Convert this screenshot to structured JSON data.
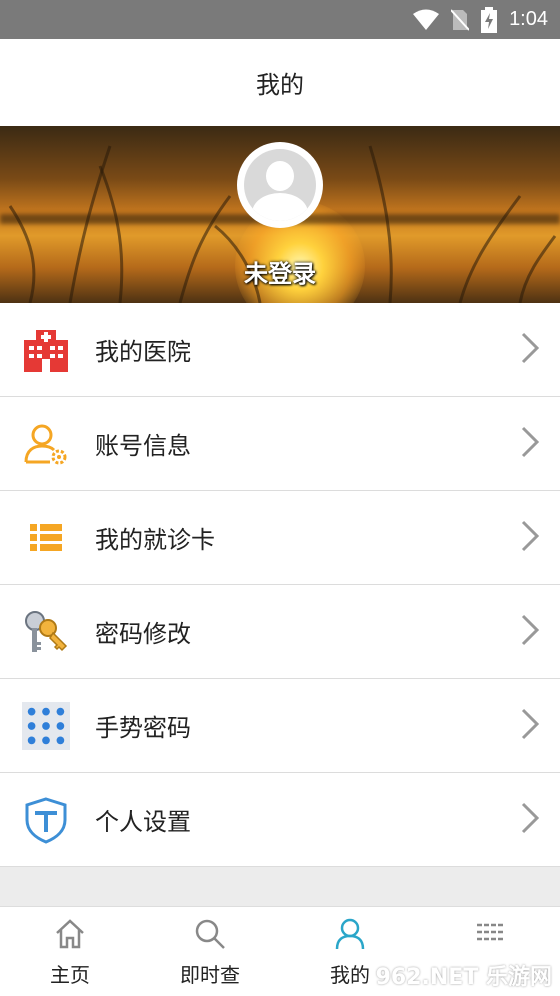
{
  "status_bar": {
    "time": "1:04"
  },
  "title_bar": {
    "title": "我的"
  },
  "profile": {
    "login_label": "未登录"
  },
  "menu": [
    {
      "label": "我的医院",
      "icon": "hospital-icon"
    },
    {
      "label": "账号信息",
      "icon": "account-settings-icon"
    },
    {
      "label": "我的就诊卡",
      "icon": "card-list-icon"
    },
    {
      "label": "密码修改",
      "icon": "key-icon"
    },
    {
      "label": "手势密码",
      "icon": "gesture-grid-icon"
    },
    {
      "label": "个人设置",
      "icon": "shield-icon"
    }
  ],
  "tabbar": [
    {
      "label": "主页",
      "icon": "home-icon"
    },
    {
      "label": "即时查",
      "icon": "search-icon"
    },
    {
      "label": "我的",
      "icon": "user-icon",
      "active": true
    },
    {
      "label": "",
      "icon": "menu-grid-icon"
    }
  ],
  "colors": {
    "accent": "#2aa6c9",
    "hospital": "#e53935",
    "account": "#f5a623",
    "shield": "#3d8fd6"
  },
  "watermark": "962.NET 乐游网"
}
